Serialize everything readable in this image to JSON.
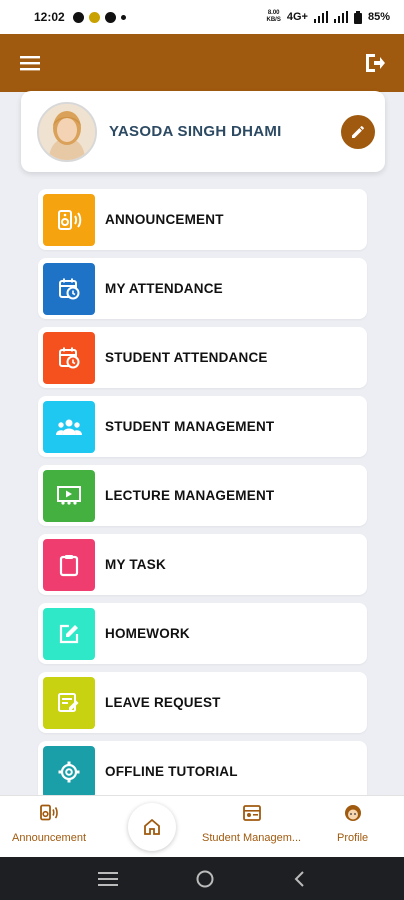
{
  "status_bar": {
    "time": "12:02",
    "net_speed_line1": "8.00",
    "net_speed_line2": "KB/S",
    "network": "4G+",
    "battery": "85%"
  },
  "app_bar": {
    "menu_icon": "hamburger-icon",
    "logout_icon": "logout-icon",
    "color": "#a05a0f"
  },
  "profile": {
    "name": "YASODA SINGH DHAMI",
    "edit_icon": "pencil-icon"
  },
  "menu": [
    {
      "label": "ANNOUNCEMENT",
      "icon": "speaker-icon",
      "color": "#f5a30f"
    },
    {
      "label": "MY ATTENDANCE",
      "icon": "calendar-clock-icon",
      "color": "#1e73c6"
    },
    {
      "label": "STUDENT ATTENDANCE",
      "icon": "calendar-clock-icon",
      "color": "#f4511e"
    },
    {
      "label": "STUDENT MANAGEMENT",
      "icon": "group-icon",
      "color": "#1ec8f0"
    },
    {
      "label": "LECTURE MANAGEMENT",
      "icon": "presentation-icon",
      "color": "#43b040"
    },
    {
      "label": "MY TASK",
      "icon": "clipboard-icon",
      "color": "#ef3d70"
    },
    {
      "label": "HOMEWORK",
      "icon": "edit-square-icon",
      "color": "#2ee8c8"
    },
    {
      "label": "LEAVE REQUEST",
      "icon": "form-edit-icon",
      "color": "#c8d210"
    },
    {
      "label": "OFFLINE TUTORIAL",
      "icon": "gear-icon",
      "color": "#1a9fa8"
    }
  ],
  "bottom_nav": {
    "announcement": "Announcement",
    "student_management": "Student Managem...",
    "profile": "Profile"
  }
}
